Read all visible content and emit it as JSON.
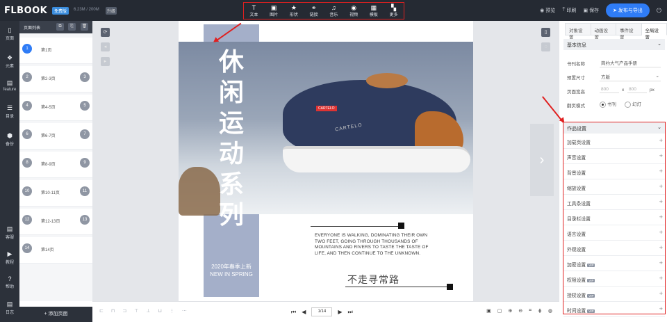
{
  "topbar": {
    "logo": "FLBOOK",
    "plan_tag": "免费版",
    "quota": "6.23M / 200M",
    "upgrade_tag": "升级",
    "tools": [
      {
        "label": "文本",
        "icon": "text-icon",
        "glyph": "T"
      },
      {
        "label": "图片",
        "icon": "image-icon",
        "glyph": "▣"
      },
      {
        "label": "形状",
        "icon": "star-icon",
        "glyph": "★"
      },
      {
        "label": "链接",
        "icon": "link-icon",
        "glyph": "⚭"
      },
      {
        "label": "音乐",
        "icon": "music-icon",
        "glyph": "♫"
      },
      {
        "label": "视频",
        "icon": "video-icon",
        "glyph": "◉"
      },
      {
        "label": "模板",
        "icon": "template-icon",
        "glyph": "▦"
      },
      {
        "label": "更多",
        "icon": "more-icon",
        "glyph": "▚"
      }
    ],
    "preview": "预览",
    "print": "印刷",
    "save": "保存",
    "publish": "发布与导出"
  },
  "leftnav": [
    {
      "label": "页面",
      "icon": "page-icon",
      "glyph": "▯"
    },
    {
      "label": "元素",
      "icon": "elements-icon",
      "glyph": "❖"
    },
    {
      "label": "feature",
      "icon": "feature-icon",
      "glyph": "▤"
    },
    {
      "label": "目录",
      "icon": "toc-icon",
      "glyph": "☰"
    },
    {
      "label": "备份",
      "icon": "backup-icon",
      "glyph": "⬢"
    },
    {
      "label": "客服",
      "icon": "service-icon",
      "glyph": "▤"
    },
    {
      "label": "教程",
      "icon": "tutorial-icon",
      "glyph": "▶"
    },
    {
      "label": "帮助",
      "icon": "help-icon",
      "glyph": "?"
    },
    {
      "label": "日志",
      "icon": "log-icon",
      "glyph": "▤"
    }
  ],
  "pages_panel": {
    "title": "页面列表",
    "pages": [
      {
        "left": "1",
        "label": "第1页",
        "right": ""
      },
      {
        "left": "2",
        "label": "第2-3页",
        "right": "3"
      },
      {
        "left": "4",
        "label": "第4-5页",
        "right": "5"
      },
      {
        "left": "6",
        "label": "第6-7页",
        "right": "7"
      },
      {
        "left": "8",
        "label": "第8-9页",
        "right": "9"
      },
      {
        "left": "10",
        "label": "第10-11页",
        "right": "11"
      },
      {
        "left": "12",
        "label": "第12-13页",
        "right": "13"
      },
      {
        "left": "14",
        "label": "第14页",
        "right": ""
      }
    ],
    "add_page": "+ 添加页面"
  },
  "page_content": {
    "vertical_title": [
      "休",
      "闲",
      "运",
      "动",
      "系",
      "列"
    ],
    "spring_cn": "2020年春季上新",
    "spring_en": "NEW IN SPRING",
    "shoe_logo": "CARTELO",
    "shoe_badge": "CARTELO",
    "body_text": "EVERYONE IS WALKING, DOMINATING THEIR OWN TWO FEET, GOING THROUGH THOUSANDS OF MOUNTAINS AND RIVERS TO TASTE THE TASTE OF LIFE, AND THEN CONTINUE TO THE UNKNOWN.",
    "slogan": "不走寻常路"
  },
  "bottombar": {
    "page_indicator": "1/14"
  },
  "right_panel": {
    "tabs": [
      "对象设置",
      "动画设置",
      "事件设置",
      "全局设置"
    ],
    "active_tab": 3,
    "basic_info": {
      "title": "基本信息",
      "book_name_label": "书刊名称",
      "book_name_value": "简约大气产品手册",
      "preset_size_label": "预置尺寸",
      "preset_size_value": "方版",
      "page_size_label": "页面宽高",
      "width_value": "800",
      "height_value": "800",
      "times": "x",
      "unit": "px",
      "flip_mode_label": "翻页模式",
      "flip_option_1": "书刊",
      "flip_option_2": "幻灯"
    },
    "work_settings": {
      "title": "作品设置",
      "items": [
        {
          "label": "加载页设置",
          "tag": ""
        },
        {
          "label": "声音设置",
          "tag": ""
        },
        {
          "label": "背景设置",
          "tag": ""
        },
        {
          "label": "缩放设置",
          "tag": ""
        },
        {
          "label": "工具条设置",
          "tag": ""
        },
        {
          "label": "目录栏设置",
          "tag": ""
        },
        {
          "label": "语言设置",
          "tag": ""
        },
        {
          "label": "外观设置",
          "tag": ""
        },
        {
          "label": "加密设置",
          "tag": "VIP"
        },
        {
          "label": "权限设置",
          "tag": "VIP"
        },
        {
          "label": "授权设置",
          "tag": "VIP"
        },
        {
          "label": "时间设置",
          "tag": "VIP"
        }
      ]
    }
  }
}
